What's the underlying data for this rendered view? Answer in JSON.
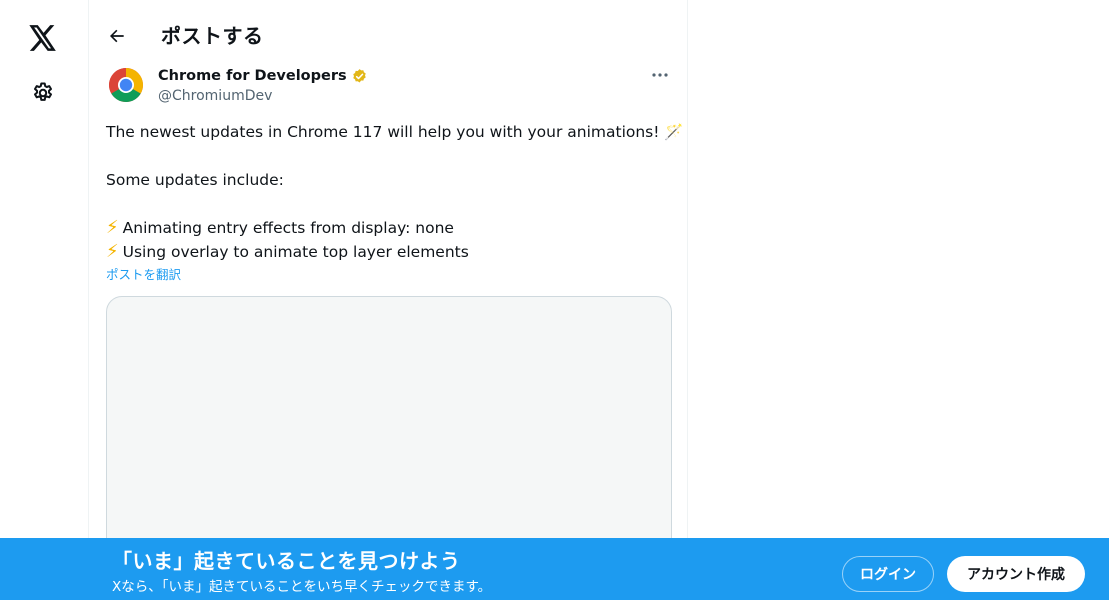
{
  "header": {
    "title": "ポストする",
    "back_icon": "arrow-left-icon"
  },
  "nav": {
    "logo_icon": "x-logo-icon",
    "settings_icon": "gear-icon"
  },
  "post": {
    "author_name": "Chrome for Developers",
    "author_handle": "@ChromiumDev",
    "verified_color": "#e2b719",
    "lines": [
      "The newest updates in Chrome 117 will help you with your animations! 🪄",
      "",
      "Some updates include:",
      "",
      "Animating entry effects from display: none",
      "Using overlay to animate top layer elements"
    ],
    "bolt_glyph": "⚡",
    "translate_label": "ポストを翻訳",
    "more_icon": "more-dots-icon"
  },
  "banner": {
    "title": "「いま」起きていることを見つけよう",
    "subtitle": "Xなら、「いま」起きていることをいち早くチェックできます。",
    "login_label": "ログイン",
    "signup_label": "アカウント作成",
    "background": "#1d9bf0"
  },
  "colors": {
    "accent": "#1d9bf0",
    "text": "#0f1419",
    "secondary_text": "#536471"
  }
}
